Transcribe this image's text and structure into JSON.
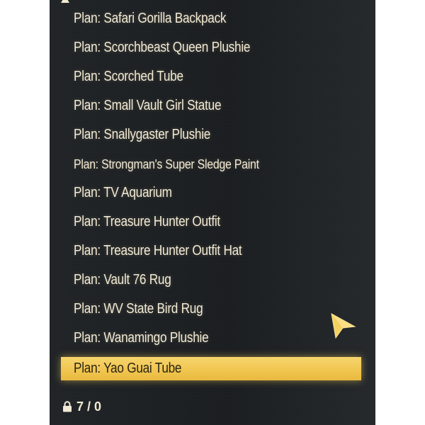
{
  "colors": {
    "panel_background": "#1e2124",
    "text": "#f2ead6",
    "selection_highlight": "#f2c851",
    "cursor": "#f5d25f"
  },
  "list": {
    "items": [
      {
        "label": "Plan: Safari Gorilla Backpack"
      },
      {
        "label": "Plan: Scorchbeast Queen Plushie"
      },
      {
        "label": "Plan: Scorched Tube"
      },
      {
        "label": "Plan: Small Vault Girl Statue"
      },
      {
        "label": "Plan: Snallygaster Plushie"
      },
      {
        "label": "Plan: Strongman's Super Sledge Paint"
      },
      {
        "label": "Plan: TV Aquarium"
      },
      {
        "label": "Plan: Treasure Hunter Outfit"
      },
      {
        "label": "Plan: Treasure Hunter Outfit Hat"
      },
      {
        "label": "Plan: Vault 76 Rug"
      },
      {
        "label": "Plan: WV State Bird Rug"
      },
      {
        "label": "Plan: Wanamingo Plushie"
      },
      {
        "label": "Plan: Yao Guai Tube",
        "selected": true
      }
    ]
  },
  "footer": {
    "icon": "lock-icon",
    "capacity_text": "7 / 0"
  },
  "icons": {
    "scroll_up": "caret-up-icon",
    "cursor": "arrow-cursor-icon"
  }
}
